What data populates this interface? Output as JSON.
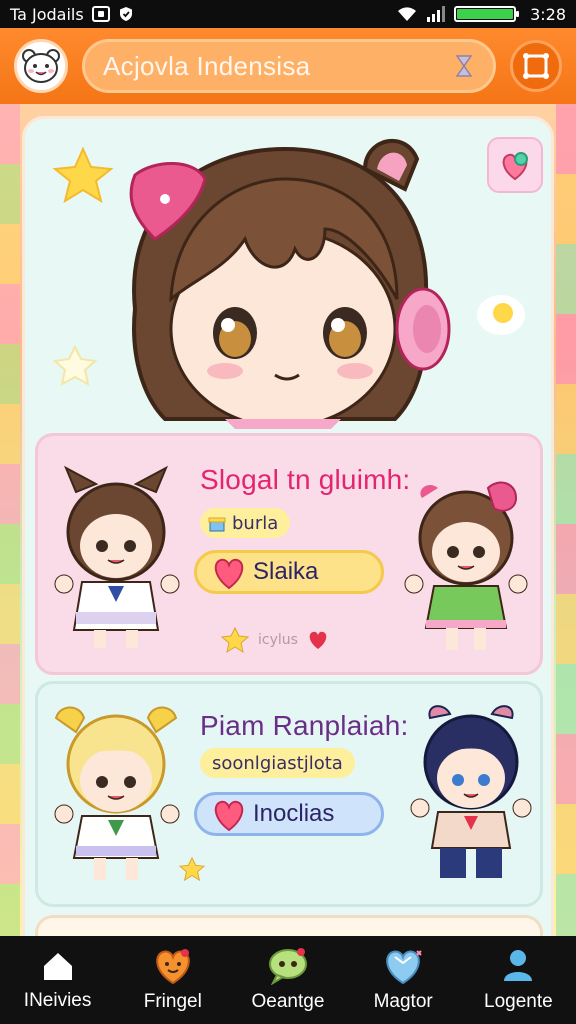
{
  "status_bar": {
    "time_left": "Ta Jodails",
    "time_right": "3:28"
  },
  "header": {
    "search_text": "Acjovla Indensisa"
  },
  "panels": [
    {
      "title": "Slogal tn gluimh:",
      "tag": "burla",
      "button": "Slaika",
      "note": "icylus"
    },
    {
      "title": "Piam Ranplaiah:",
      "tag": "soonlgiastjlota",
      "button": "Inoclias"
    }
  ],
  "nav": {
    "items": [
      {
        "label": "INeivies",
        "icon": "home-icon"
      },
      {
        "label": "Fringel",
        "icon": "heart-face-icon"
      },
      {
        "label": "Oeantge",
        "icon": "chat-bubble-icon"
      },
      {
        "label": "Magtor",
        "icon": "heart-gem-icon"
      },
      {
        "label": "Logente",
        "icon": "user-icon"
      }
    ]
  },
  "colors": {
    "header_orange": "#f47515",
    "panel_pink": "#fadbe8",
    "panel_mint": "#e4f7f4",
    "accent_pink": "#e4246e"
  }
}
